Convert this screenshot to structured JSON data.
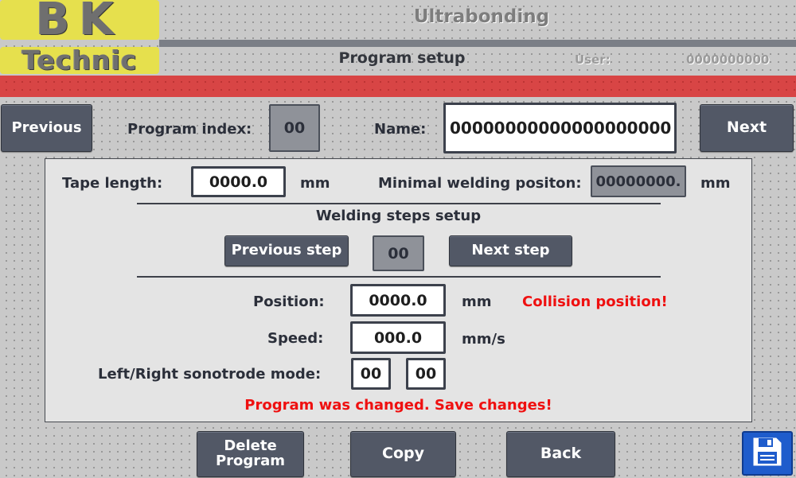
{
  "logo": {
    "line1": "BK",
    "line2": "Technic"
  },
  "header": {
    "title": "Ultrabonding",
    "subtitle": "Program setup",
    "user_label": "User:",
    "user_value": "0000000000"
  },
  "colors": {
    "alarm_bar": "#d84545",
    "logo_bg": "#e6e04d",
    "button": "#525866",
    "warning_text": "#ef1010",
    "save_button": "#1e5ccc"
  },
  "top_row": {
    "previous_label": "Previous",
    "program_index_label": "Program index:",
    "program_index_value": "00",
    "name_label": "Name:",
    "name_value": "00000000000000000000",
    "next_label": "Next"
  },
  "panel": {
    "tape_length_label": "Tape length:",
    "tape_length_value": "0000.0",
    "tape_length_unit": "mm",
    "min_weld_label": "Minimal welding positon:",
    "min_weld_value": "00000000.",
    "min_weld_unit": "mm",
    "steps_title": "Welding steps setup",
    "prev_step_label": "Previous step",
    "step_index_value": "00",
    "next_step_label": "Next step",
    "position_label": "Position:",
    "position_value": "0000.0",
    "position_unit": "mm",
    "collision_warning": "Collision position!",
    "speed_label": "Speed:",
    "speed_value": "000.0",
    "speed_unit": "mm/s",
    "sonotrode_label": "Left/Right sonotrode mode:",
    "left_mode_value": "00",
    "right_mode_value": "00",
    "changed_warning": "Program was changed. Save changes!"
  },
  "bottom": {
    "delete_line1": "Delete",
    "delete_line2": "Program",
    "copy_label": "Copy",
    "back_label": "Back",
    "save_icon": "floppy-disk-icon"
  }
}
